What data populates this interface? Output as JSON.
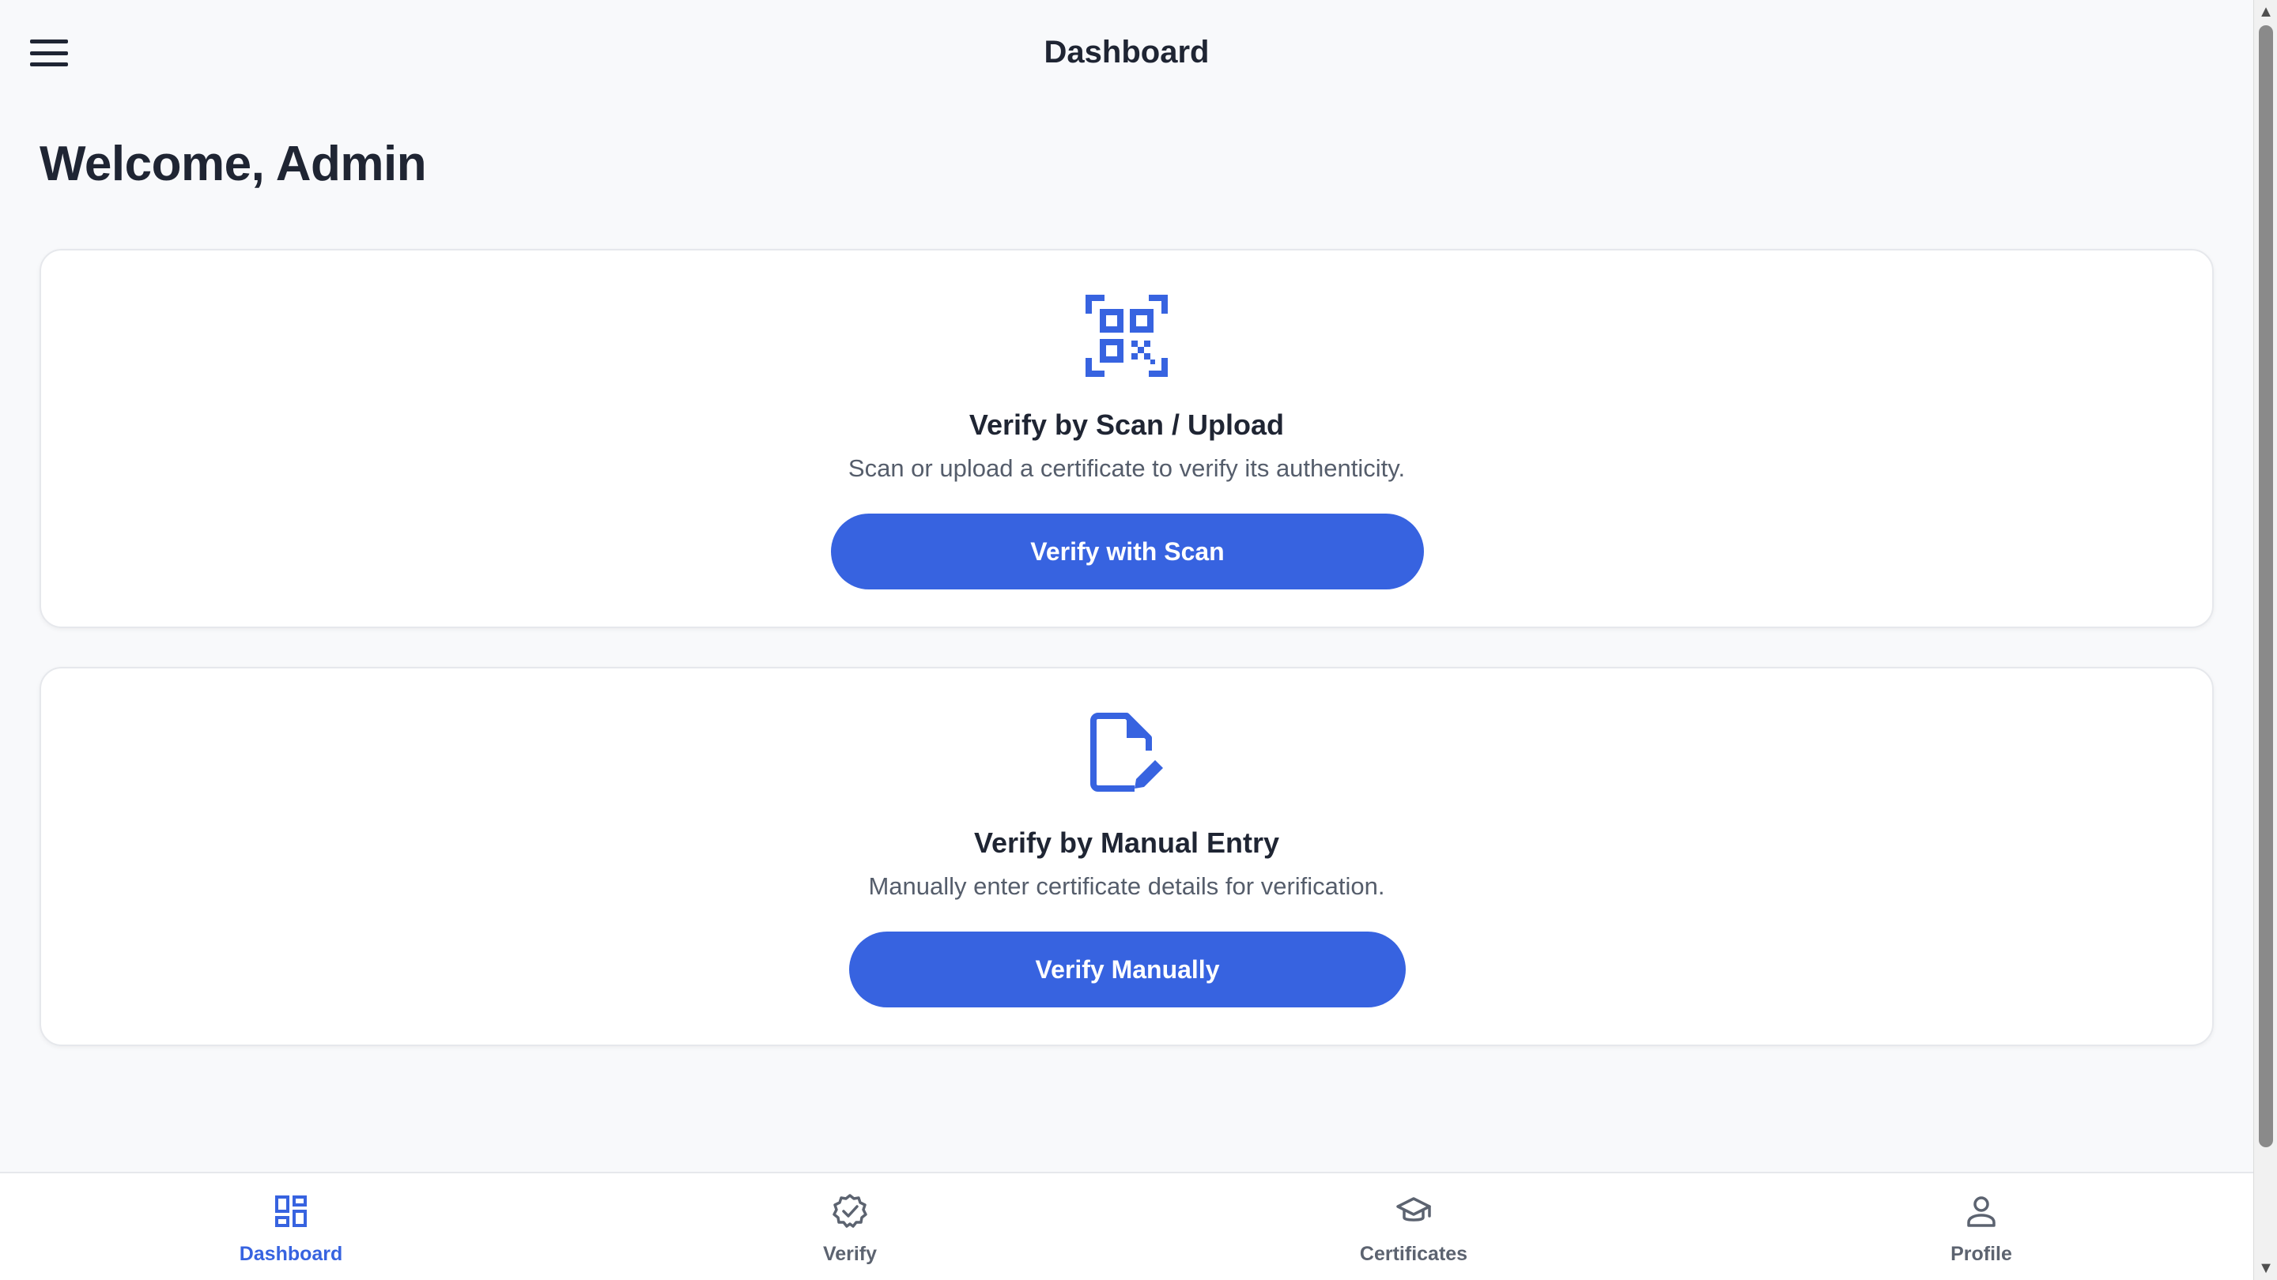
{
  "header": {
    "title": "Dashboard"
  },
  "welcome": "Welcome, Admin",
  "cards": [
    {
      "icon": "qr-scan-icon",
      "title": "Verify by Scan / Upload",
      "description": "Scan or upload a certificate to verify its authenticity.",
      "button_label": "Verify with Scan"
    },
    {
      "icon": "document-edit-icon",
      "title": "Verify by Manual Entry",
      "description": "Manually enter certificate details for verification.",
      "button_label": "Verify Manually"
    }
  ],
  "bottom_nav": {
    "items": [
      {
        "label": "Dashboard",
        "icon": "dashboard-grid-icon",
        "active": true
      },
      {
        "label": "Verify",
        "icon": "verified-badge-icon",
        "active": false
      },
      {
        "label": "Certificates",
        "icon": "graduation-cap-icon",
        "active": false
      },
      {
        "label": "Profile",
        "icon": "person-icon",
        "active": false
      }
    ]
  },
  "colors": {
    "accent": "#3763e0",
    "background": "#f8f9fb",
    "card": "#ffffff",
    "text_primary": "#1f2533",
    "text_secondary": "#555d6b",
    "nav_inactive": "#5c6370"
  }
}
